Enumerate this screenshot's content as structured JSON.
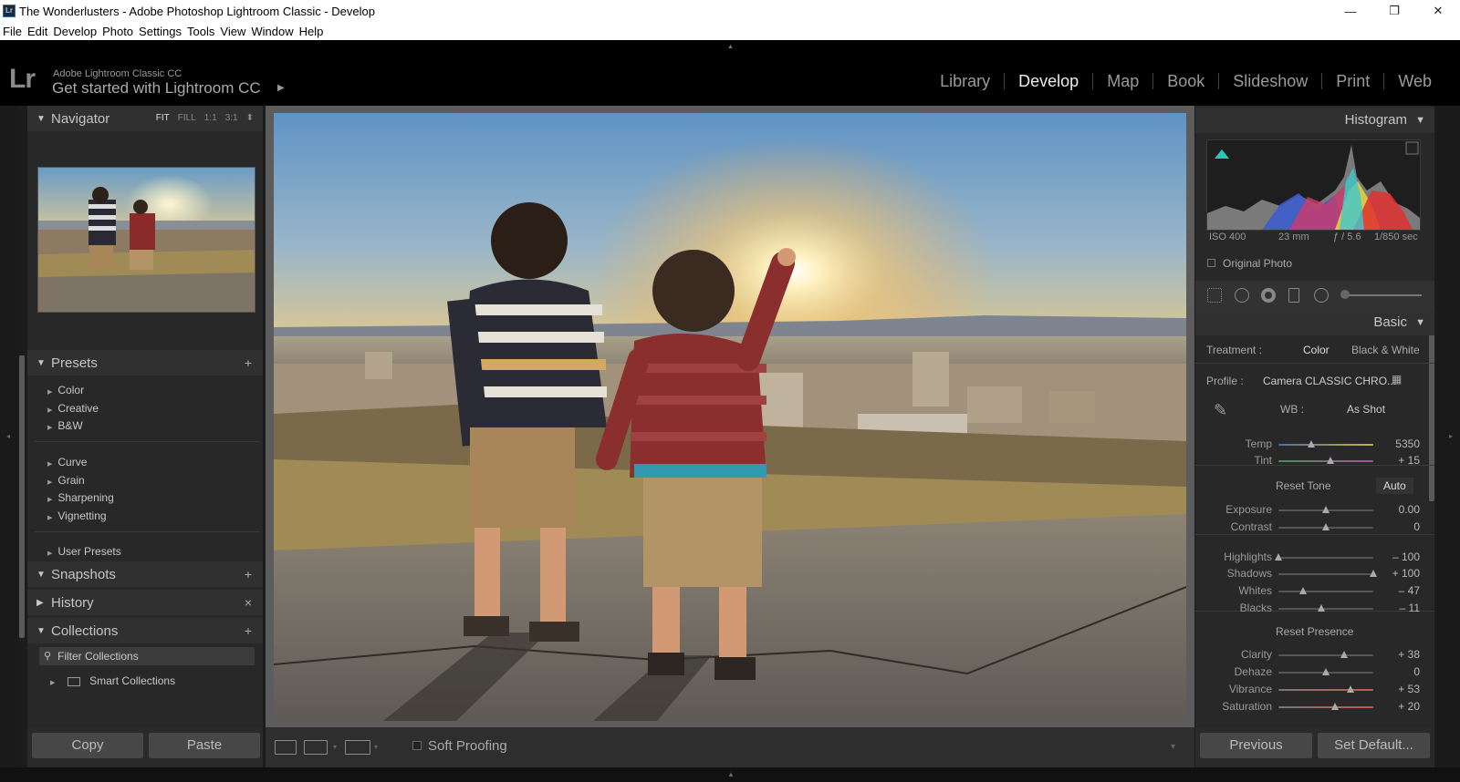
{
  "window": {
    "title": "The Wonderlusters - Adobe Photoshop Lightroom Classic - Develop",
    "app_icon": "Lr",
    "minimize": "—",
    "restore": "❐",
    "close": "✕"
  },
  "menu": [
    "File",
    "Edit",
    "Develop",
    "Photo",
    "Settings",
    "Tools",
    "View",
    "Window",
    "Help"
  ],
  "identity": {
    "logo": "Lr",
    "product": "Adobe Lightroom Classic CC",
    "tagline": "Get started with Lightroom CC"
  },
  "modules": [
    {
      "label": "Library",
      "active": false
    },
    {
      "label": "Develop",
      "active": true
    },
    {
      "label": "Map",
      "active": false
    },
    {
      "label": "Book",
      "active": false
    },
    {
      "label": "Slideshow",
      "active": false
    },
    {
      "label": "Print",
      "active": false
    },
    {
      "label": "Web",
      "active": false
    }
  ],
  "navigator": {
    "title": "Navigator",
    "options": [
      "FIT",
      "FILL",
      "1:1",
      "3:1"
    ],
    "active_option": "FIT"
  },
  "presets": {
    "title": "Presets",
    "groups": [
      [
        "Color",
        "Creative",
        "B&W"
      ],
      [
        "Curve",
        "Grain",
        "Sharpening",
        "Vignetting"
      ],
      [
        "User Presets"
      ]
    ]
  },
  "snapshots": {
    "title": "Snapshots"
  },
  "history": {
    "title": "History"
  },
  "collections": {
    "title": "Collections",
    "filter_placeholder": "Filter Collections",
    "smart": "Smart Collections"
  },
  "left_buttons": {
    "copy": "Copy",
    "paste": "Paste"
  },
  "toolbar": {
    "soft_proofing": "Soft Proofing"
  },
  "histogram": {
    "title": "Histogram",
    "iso": "ISO 400",
    "focal": "23 mm",
    "aperture": "ƒ / 5.6",
    "shutter": "1/850 sec",
    "original_photo": "Original Photo"
  },
  "basic": {
    "title": "Basic",
    "treatment_label": "Treatment :",
    "treatment_color": "Color",
    "treatment_bw": "Black & White",
    "profile_label": "Profile :",
    "profile_value": "Camera CLASSIC CHRO...",
    "wb_label": "WB :",
    "wb_value": "As Shot",
    "reset_tone": "Reset Tone",
    "auto": "Auto",
    "reset_presence": "Reset Presence",
    "sliders": {
      "temp": {
        "label": "Temp",
        "value": "5350",
        "pos": 0.35
      },
      "tint": {
        "label": "Tint",
        "value": "+ 15",
        "pos": 0.55
      },
      "exposure": {
        "label": "Exposure",
        "value": "0.00",
        "pos": 0.5
      },
      "contrast": {
        "label": "Contrast",
        "value": "0",
        "pos": 0.5
      },
      "highlights": {
        "label": "Highlights",
        "value": "– 100",
        "pos": 0.0
      },
      "shadows": {
        "label": "Shadows",
        "value": "+ 100",
        "pos": 1.0
      },
      "whites": {
        "label": "Whites",
        "value": "– 47",
        "pos": 0.26
      },
      "blacks": {
        "label": "Blacks",
        "value": "– 11",
        "pos": 0.45
      },
      "clarity": {
        "label": "Clarity",
        "value": "+ 38",
        "pos": 0.69
      },
      "dehaze": {
        "label": "Dehaze",
        "value": "0",
        "pos": 0.5
      },
      "vibrance": {
        "label": "Vibrance",
        "value": "+ 53",
        "pos": 0.76
      },
      "saturation": {
        "label": "Saturation",
        "value": "+ 20",
        "pos": 0.6
      }
    }
  },
  "right_buttons": {
    "previous": "Previous",
    "set_default": "Set Default..."
  }
}
